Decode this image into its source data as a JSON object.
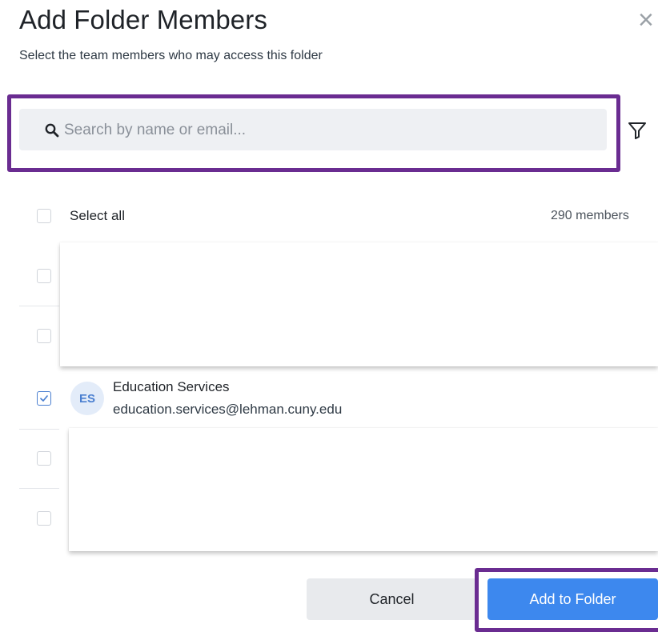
{
  "dialog": {
    "title": "Add Folder Members",
    "subtitle": "Select the team members who may access this folder",
    "close_symbol": "×"
  },
  "search": {
    "placeholder": "Search by name or email...",
    "value": "",
    "icon": "search-icon",
    "filter_icon": "filter-icon"
  },
  "list": {
    "select_all_label": "Select all",
    "member_count": "290 members",
    "members": [
      {
        "checked": false
      },
      {
        "checked": false
      },
      {
        "initials": "ES",
        "name": "Education Services",
        "email": "education.services@lehman.cuny.edu",
        "checked": true
      },
      {
        "checked": false
      },
      {
        "checked": false
      }
    ]
  },
  "buttons": {
    "cancel_label": "Cancel",
    "add_label": "Add to Folder"
  },
  "colors": {
    "primary": "#3d88ee",
    "highlight": "#6a2c91",
    "avatar_bg": "#e3ecf9"
  }
}
